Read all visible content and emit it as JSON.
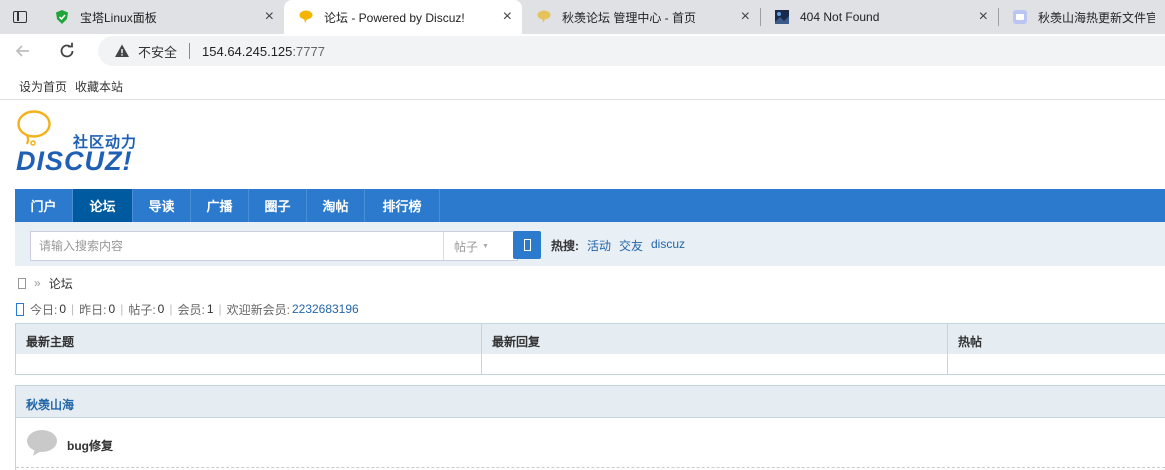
{
  "browser": {
    "tabs": [
      {
        "title": "宝塔Linux面板",
        "icon": "bt-shield-icon",
        "active": false
      },
      {
        "title": "论坛 - Powered by Discuz!",
        "icon": "discuz-bubble-icon",
        "active": true
      },
      {
        "title": "秋羡论坛 管理中心 - 首页",
        "icon": "discuz-bubble-icon",
        "active": false
      },
      {
        "title": "404 Not Found",
        "icon": "dark-image-icon",
        "active": false
      },
      {
        "title": "秋羡山海热更新文件官方",
        "icon": "app-icon",
        "active": false
      }
    ],
    "address": {
      "security_label": "不安全",
      "host": "154.64.245.125",
      "port": ":7777"
    },
    "bookmarks": [
      "设为首页",
      "收藏本站"
    ]
  },
  "logo": {
    "tagline": "社区动力",
    "wordmark": "DISCUZ!"
  },
  "nav": {
    "items": [
      "门户",
      "论坛",
      "导读",
      "广播",
      "圈子",
      "淘帖",
      "排行榜"
    ],
    "active_index": 1,
    "color": "#2b7acd"
  },
  "search": {
    "placeholder": "请输入搜索内容",
    "type_label": "帖子",
    "hot_label": "热搜:",
    "hot_links": [
      "活动",
      "交友",
      "discuz"
    ]
  },
  "breadcrumb": {
    "current": "论坛",
    "separator": "»"
  },
  "stats": {
    "today_label": "今日:",
    "today": "0",
    "yesterday_label": "昨日:",
    "yesterday": "0",
    "posts_label": "帖子:",
    "posts": "0",
    "members_label": "会员:",
    "members": "1",
    "welcome_label": "欢迎新会员:",
    "new_member": "2232683196"
  },
  "latest": {
    "columns": [
      "最新主题",
      "最新回复",
      "热帖"
    ]
  },
  "forum": {
    "category": "秋羡山海",
    "boards": [
      {
        "name": "bug修复"
      }
    ]
  }
}
